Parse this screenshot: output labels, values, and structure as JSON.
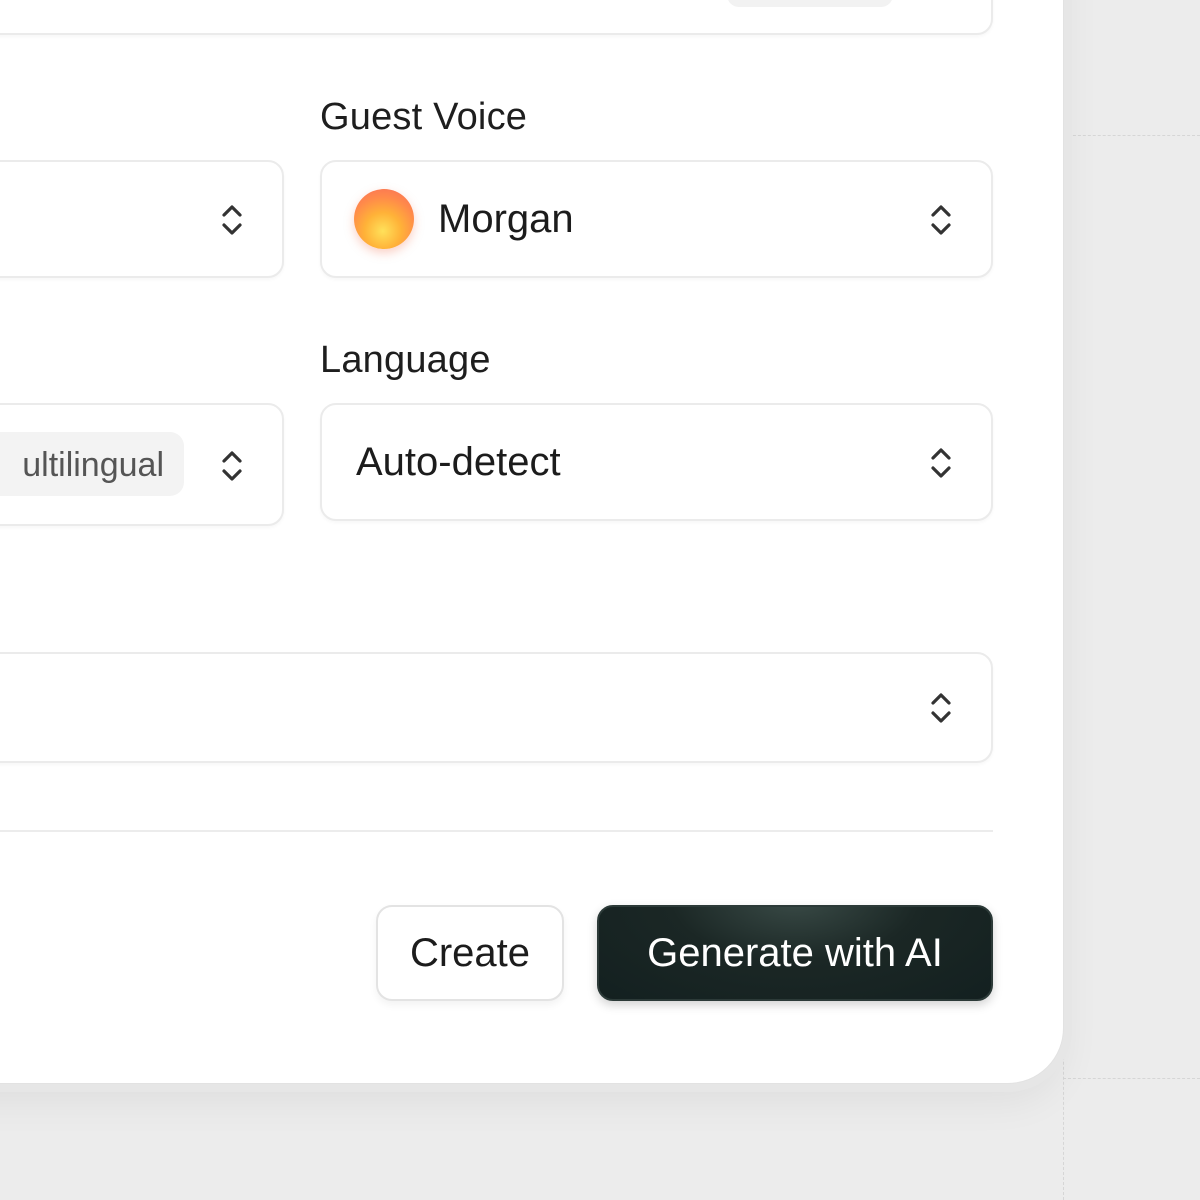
{
  "form": {
    "guest_voice": {
      "label": "Guest Voice",
      "value": "Morgan",
      "avatar_icon": "voice-avatar-orb"
    },
    "language": {
      "label": "Language",
      "value": "Auto-detect"
    },
    "model": {
      "badge": "ultilingual"
    }
  },
  "actions": {
    "create_label": "Create",
    "generate_label": "Generate with AI"
  },
  "icons": {
    "select": "chevron-up-down-icon"
  },
  "colors": {
    "primary_button": "#15201f",
    "avatar_gradient": [
      "#ffe15a",
      "#ffb238",
      "#f86a5c"
    ]
  }
}
